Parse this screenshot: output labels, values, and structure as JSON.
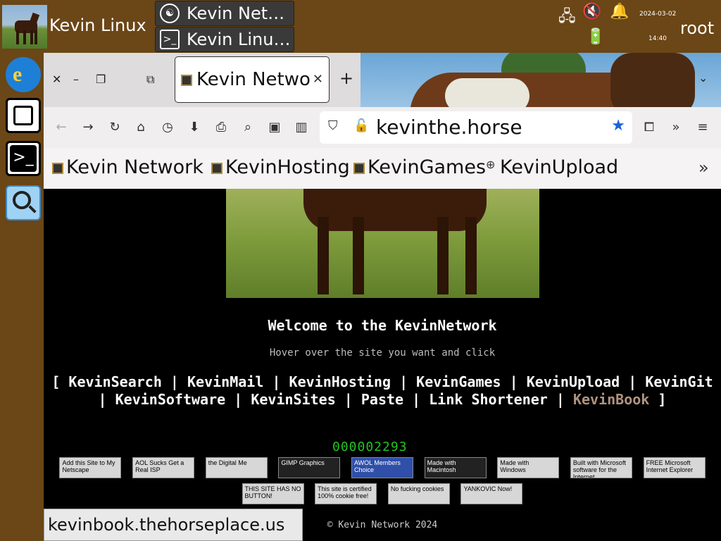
{
  "os": {
    "title": "Kevin Linux",
    "user": "root",
    "clock": {
      "date": "2024-03-02",
      "time": "14:40"
    },
    "taskbar": [
      {
        "label": "Kevin Net…",
        "icon": "firefox-icon"
      },
      {
        "label": "Kevin Linu…",
        "icon": "terminal-icon"
      }
    ],
    "tray_icons": [
      "network-icon",
      "volume-muted-icon",
      "bell-icon",
      "battery-charging-icon"
    ],
    "dock": [
      "internet-explorer-icon",
      "file-manager-icon",
      "terminal-icon",
      "magnifier-icon"
    ]
  },
  "browser": {
    "tab_title": "Kevin Netwo",
    "url": "kevinthe.horse",
    "bookmarks": [
      "Kevin Network",
      "KevinHosting",
      "KevinGames",
      "KevinUpload"
    ],
    "status_url": "kevinbook.thehorseplace.us"
  },
  "page": {
    "welcome": "Welcome to the KevinNetwork",
    "hover": "Hover over the site you want and click",
    "open_bracket": "[",
    "close_bracket": "]",
    "separator": "|",
    "links": [
      "KevinSearch",
      "KevinMail",
      "KevinHosting",
      "KevinGames",
      "KevinUpload",
      "KevinGit",
      "KevinSoftware",
      "KevinSites",
      "Paste",
      "Link Shortener",
      "KevinBook"
    ],
    "counter": "000002293",
    "badges_row1": [
      "Add this Site to My Netscape",
      "AOL Sucks Get a Real ISP",
      "the Digital Me",
      "GIMP Graphics",
      "AWOL Members Choice",
      "Made with Macintosh",
      "Made with Windows",
      "Built with Microsoft software for the Internet",
      "FREE Microsoft Internet Explorer"
    ],
    "badges_row2": [
      "THIS SITE HAS NO BUTTON!",
      "This site is certified 100% cookie free!",
      "No fucking cookies",
      "YANKOVIC Now!"
    ],
    "footer": "© Kevin Network 2024"
  }
}
